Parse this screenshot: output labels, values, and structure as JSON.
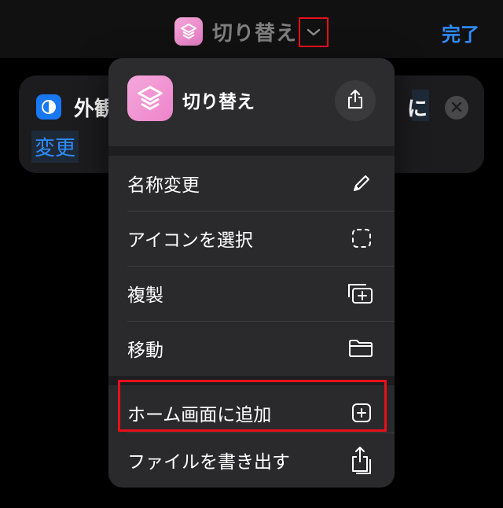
{
  "navbar": {
    "title": "切り替え",
    "done_label": "完了",
    "app_icon": "shortcuts-layers-icon",
    "chevron_icon": "chevron-down-icon"
  },
  "background_card": {
    "action_icon": "safari-compass-icon",
    "text_left": "外観",
    "text_right": "に",
    "link_text": "変更",
    "close_icon": "close-circle-icon"
  },
  "menu": {
    "header_title": "切り替え",
    "share_icon": "share-icon",
    "items": [
      {
        "label": "名称変更",
        "icon": "pencil-icon"
      },
      {
        "label": "アイコンを選択",
        "icon": "dashed-square-icon"
      },
      {
        "label": "複製",
        "icon": "duplicate-icon"
      },
      {
        "label": "移動",
        "icon": "folder-icon"
      },
      {
        "label": "ホーム画面に追加",
        "icon": "plus-square-icon"
      },
      {
        "label": "ファイルを書き出す",
        "icon": "export-icon"
      }
    ]
  },
  "colors": {
    "accent": "#2f8cff",
    "highlight": "#e8101a",
    "shortcut_pink": "#ec84ca"
  }
}
